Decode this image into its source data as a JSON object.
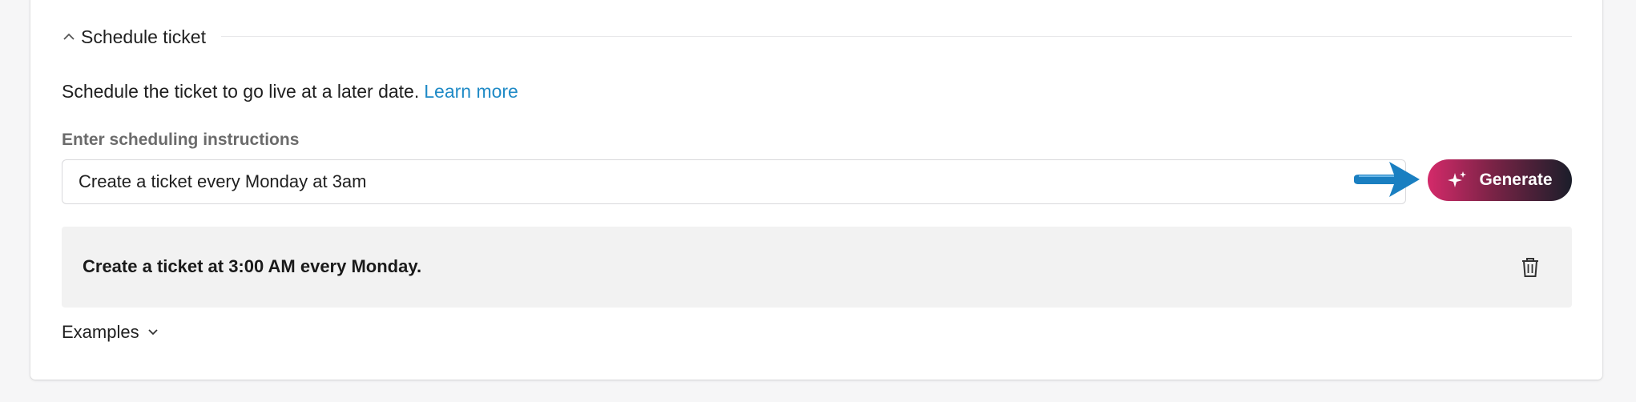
{
  "section": {
    "title": "Schedule ticket"
  },
  "description": {
    "text": "Schedule the ticket to go live at a later date.",
    "link": "Learn more"
  },
  "scheduling": {
    "label": "Enter scheduling instructions",
    "input_value": "Create a ticket every Monday at 3am"
  },
  "generate": {
    "label": "Generate",
    "icon": "sparkle-icon"
  },
  "result": {
    "text": "Create a ticket at 3:00 AM every Monday.",
    "delete_icon": "trash-icon"
  },
  "examples": {
    "label": "Examples"
  },
  "colors": {
    "link": "#1f8ac6",
    "arrow": "#1a7fc1",
    "button_gradient_start": "#d42a6a",
    "button_gradient_end": "#1b1e2a",
    "result_bg": "#f2f2f2"
  }
}
